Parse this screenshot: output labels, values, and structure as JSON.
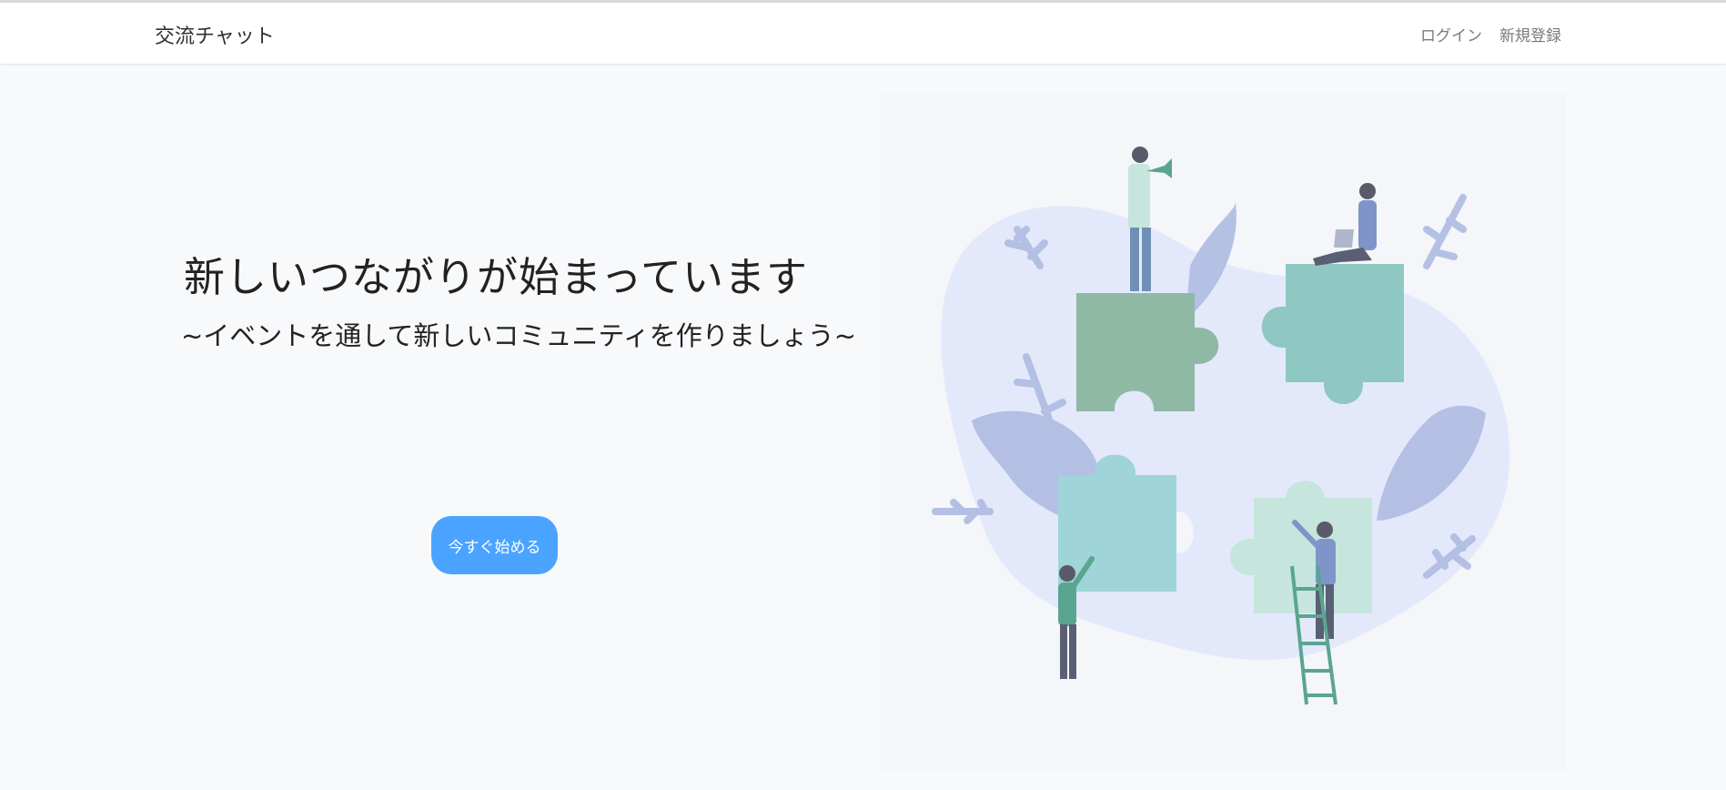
{
  "navbar": {
    "brand": "交流チャット",
    "links": [
      {
        "label": "ログイン"
      },
      {
        "label": "新規登録"
      }
    ]
  },
  "hero": {
    "title": "新しいつながりが始まっています",
    "subtitle": "~イベントを通して新しいコミュニティを作りましょう~",
    "cta_label": "今すぐ始める"
  },
  "colors": {
    "accent": "#4aa3ff",
    "puzzle_dark_green": "#8fb9a5",
    "puzzle_teal": "#8fc8c2",
    "puzzle_cyan": "#9fd4d9",
    "puzzle_light": "#c6e5dd",
    "blob": "#e3e9fb",
    "leaves": "#aebbe1"
  },
  "illustration": {
    "icon": "people-assembling-puzzle-illustration"
  }
}
